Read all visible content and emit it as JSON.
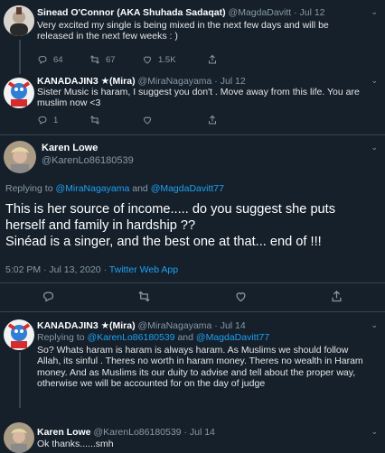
{
  "tweet1": {
    "name": "Sinead O'Connor (AKA Shuhada Sadaqat)",
    "handle": "@MagdaDavitt",
    "sep": "·",
    "date": "Jul 12",
    "text": "Very excited my single is being mixed in the next few days and will be released in the next few weeks : )",
    "replies": "64",
    "retweets": "67",
    "likes": "1.5K"
  },
  "tweet2": {
    "name": "KANADAJIN3 ★(Mira)",
    "handle": "@MiraNagayama",
    "sep": "·",
    "date": "Jul 12",
    "text": "Sister Music is haram, I suggest you don't . Move away from this life. You are muslim now <3",
    "replies": "1"
  },
  "main_tweet": {
    "name": "Karen Lowe",
    "handle": "@KarenLo86180539",
    "replying_prefix": "Replying to",
    "replying_user1": "@MiraNagayama",
    "replying_and": "and",
    "replying_user2": "@MagdaDavitt77",
    "text_line1": "This is her source of income..... do you suggest she puts",
    "text_line2": "herself and family in hardship ??",
    "text_line3": "Sinéad is a singer, and the best one at that... end of !!!",
    "time": "5:02 PM · Jul 13, 2020 ·",
    "client": "Twitter Web App"
  },
  "tweet3": {
    "name": "KANADAJIN3 ★(Mira)",
    "handle": "@MiraNagayama",
    "sep": "·",
    "date": "Jul 14",
    "replying_prefix": "Replying to",
    "replying_user1": "@KarenLo86180539",
    "replying_and": "and",
    "replying_user2": "@MagdaDavitt77",
    "text": "So?  Whats haram is haram is always haram. As Muslims we should follow Allah, its sinful . Theres no worth in haram money. Theres no wealth in Haram money. And as Muslims its our duity to advise and tell about the proper way, otherwise we will be accounted for on the day of judge"
  },
  "tweet4": {
    "name": "Karen Lowe",
    "handle": "@KarenLo86180539",
    "sep": "·",
    "date": "Jul 14",
    "text": "Ok thanks......smh"
  },
  "icons": {
    "reply": "reply-icon",
    "retweet": "retweet-icon",
    "like": "heart-icon",
    "share": "share-icon",
    "more": "chevron-down-icon"
  },
  "colors": {
    "background": "#15202b",
    "accent": "#1da1f2",
    "muted": "#8899a6",
    "divider": "#38444d"
  }
}
